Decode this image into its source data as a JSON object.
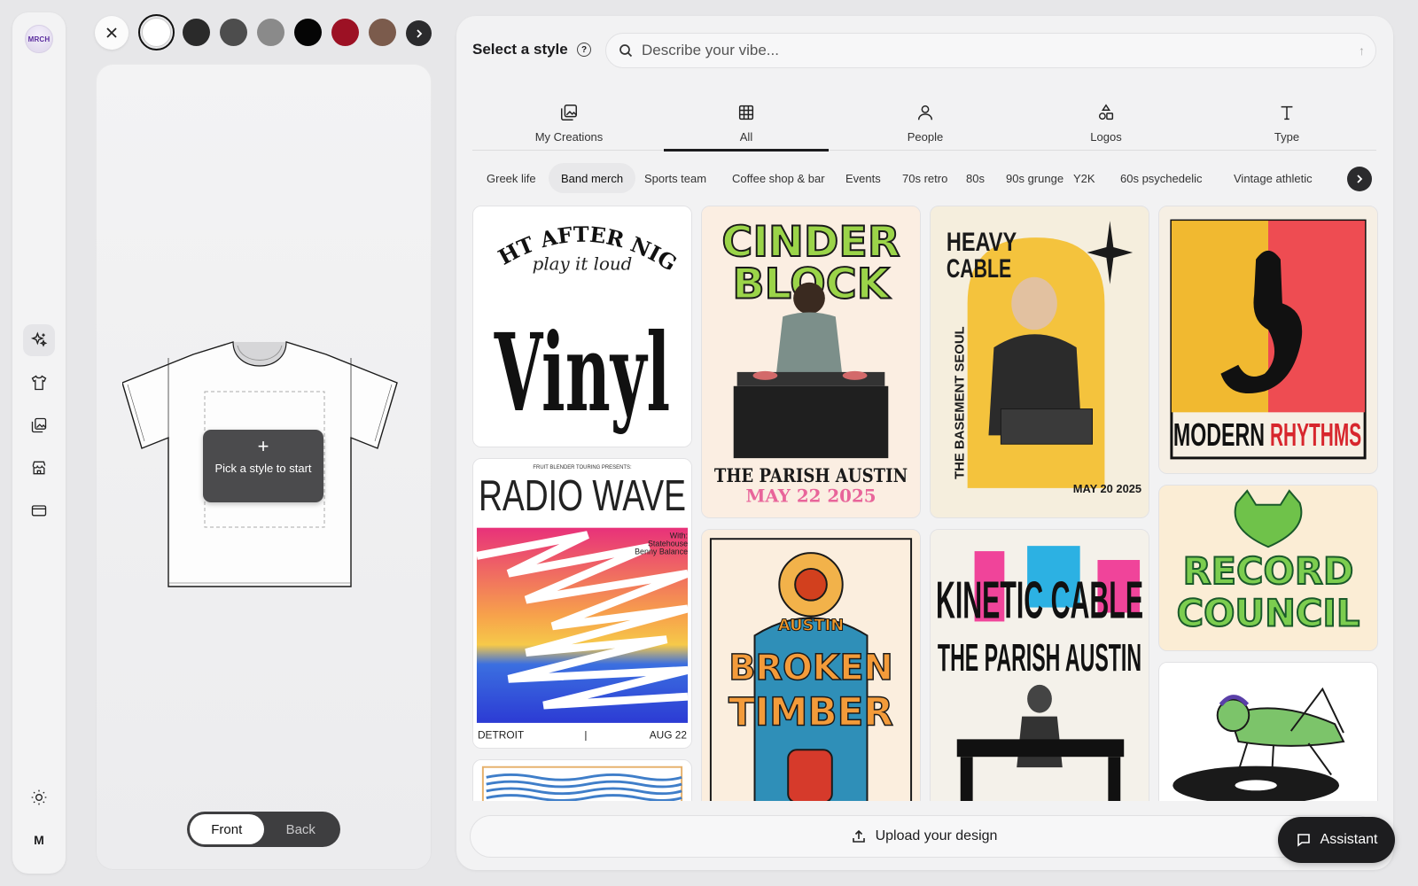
{
  "app": {
    "logo_text": "MRCH",
    "rail_user_initial": "M"
  },
  "preview": {
    "swatches": [
      "#ffffff",
      "#2a2a2a",
      "#4d4d4d",
      "#8a8a8a",
      "#050505",
      "#9c1124",
      "#7b5b4c"
    ],
    "selected_swatch": "#ffffff",
    "pick_style_text": "Pick a style to start",
    "view_front": "Front",
    "view_back": "Back",
    "active_view": "Front"
  },
  "header": {
    "title": "Select a style",
    "search_placeholder": "Describe your vibe..."
  },
  "tabs": [
    {
      "label": "My Creations",
      "icon": "image-gallery-icon"
    },
    {
      "label": "All",
      "icon": "grid-icon",
      "active": true
    },
    {
      "label": "People",
      "icon": "person-icon"
    },
    {
      "label": "Logos",
      "icon": "shapes-icon"
    },
    {
      "label": "Type",
      "icon": "type-icon"
    }
  ],
  "chips": [
    {
      "label": "Greek life"
    },
    {
      "label": "Band merch",
      "active": true
    },
    {
      "label": "Sports team"
    },
    {
      "label": "Coffee shop & bar"
    },
    {
      "label": "Events"
    },
    {
      "label": "70s retro"
    },
    {
      "label": "80s"
    },
    {
      "label": "90s grunge"
    },
    {
      "label": "Y2K"
    },
    {
      "label": "60s psychedelic"
    },
    {
      "label": "Vintage athletic"
    }
  ],
  "designs": {
    "vinyl": {
      "line1": "NIGHT AFTER NIGHT",
      "line2": "play it loud",
      "big": "Vinyl"
    },
    "cinder": {
      "title1": "CINDER",
      "title2": "BLOCK",
      "venue": "THE PARISH AUSTIN",
      "date": "MAY 22 2025"
    },
    "heavy": {
      "title1": "HEAVY",
      "title2": "CABLE",
      "side": "THE BASEMENT SEOUL",
      "date": "MAY 20 2025"
    },
    "modern": {
      "word1": "MODERN",
      "word2": "RHYTHMS"
    },
    "radio": {
      "presents": "FRUIT BLENDER TOURING PRESENTS:",
      "title": "RADIO WAVE",
      "with1": "With:",
      "with2": "Statehouse",
      "with3": "Benny Balance",
      "city": "DETROIT",
      "sep": "|",
      "date": "AUG 22"
    },
    "broken": {
      "top": "AUSTIN",
      "word1": "BROKEN",
      "word2": "TIMBER"
    },
    "kinetic": {
      "title": "KINETIC CABLE",
      "venue": "THE PARISH AUSTIN"
    },
    "record": {
      "word1": "RECORD",
      "word2": "COUNCIL"
    }
  },
  "footer": {
    "upload_label": "Upload your design",
    "assistant_label": "Assistant"
  }
}
